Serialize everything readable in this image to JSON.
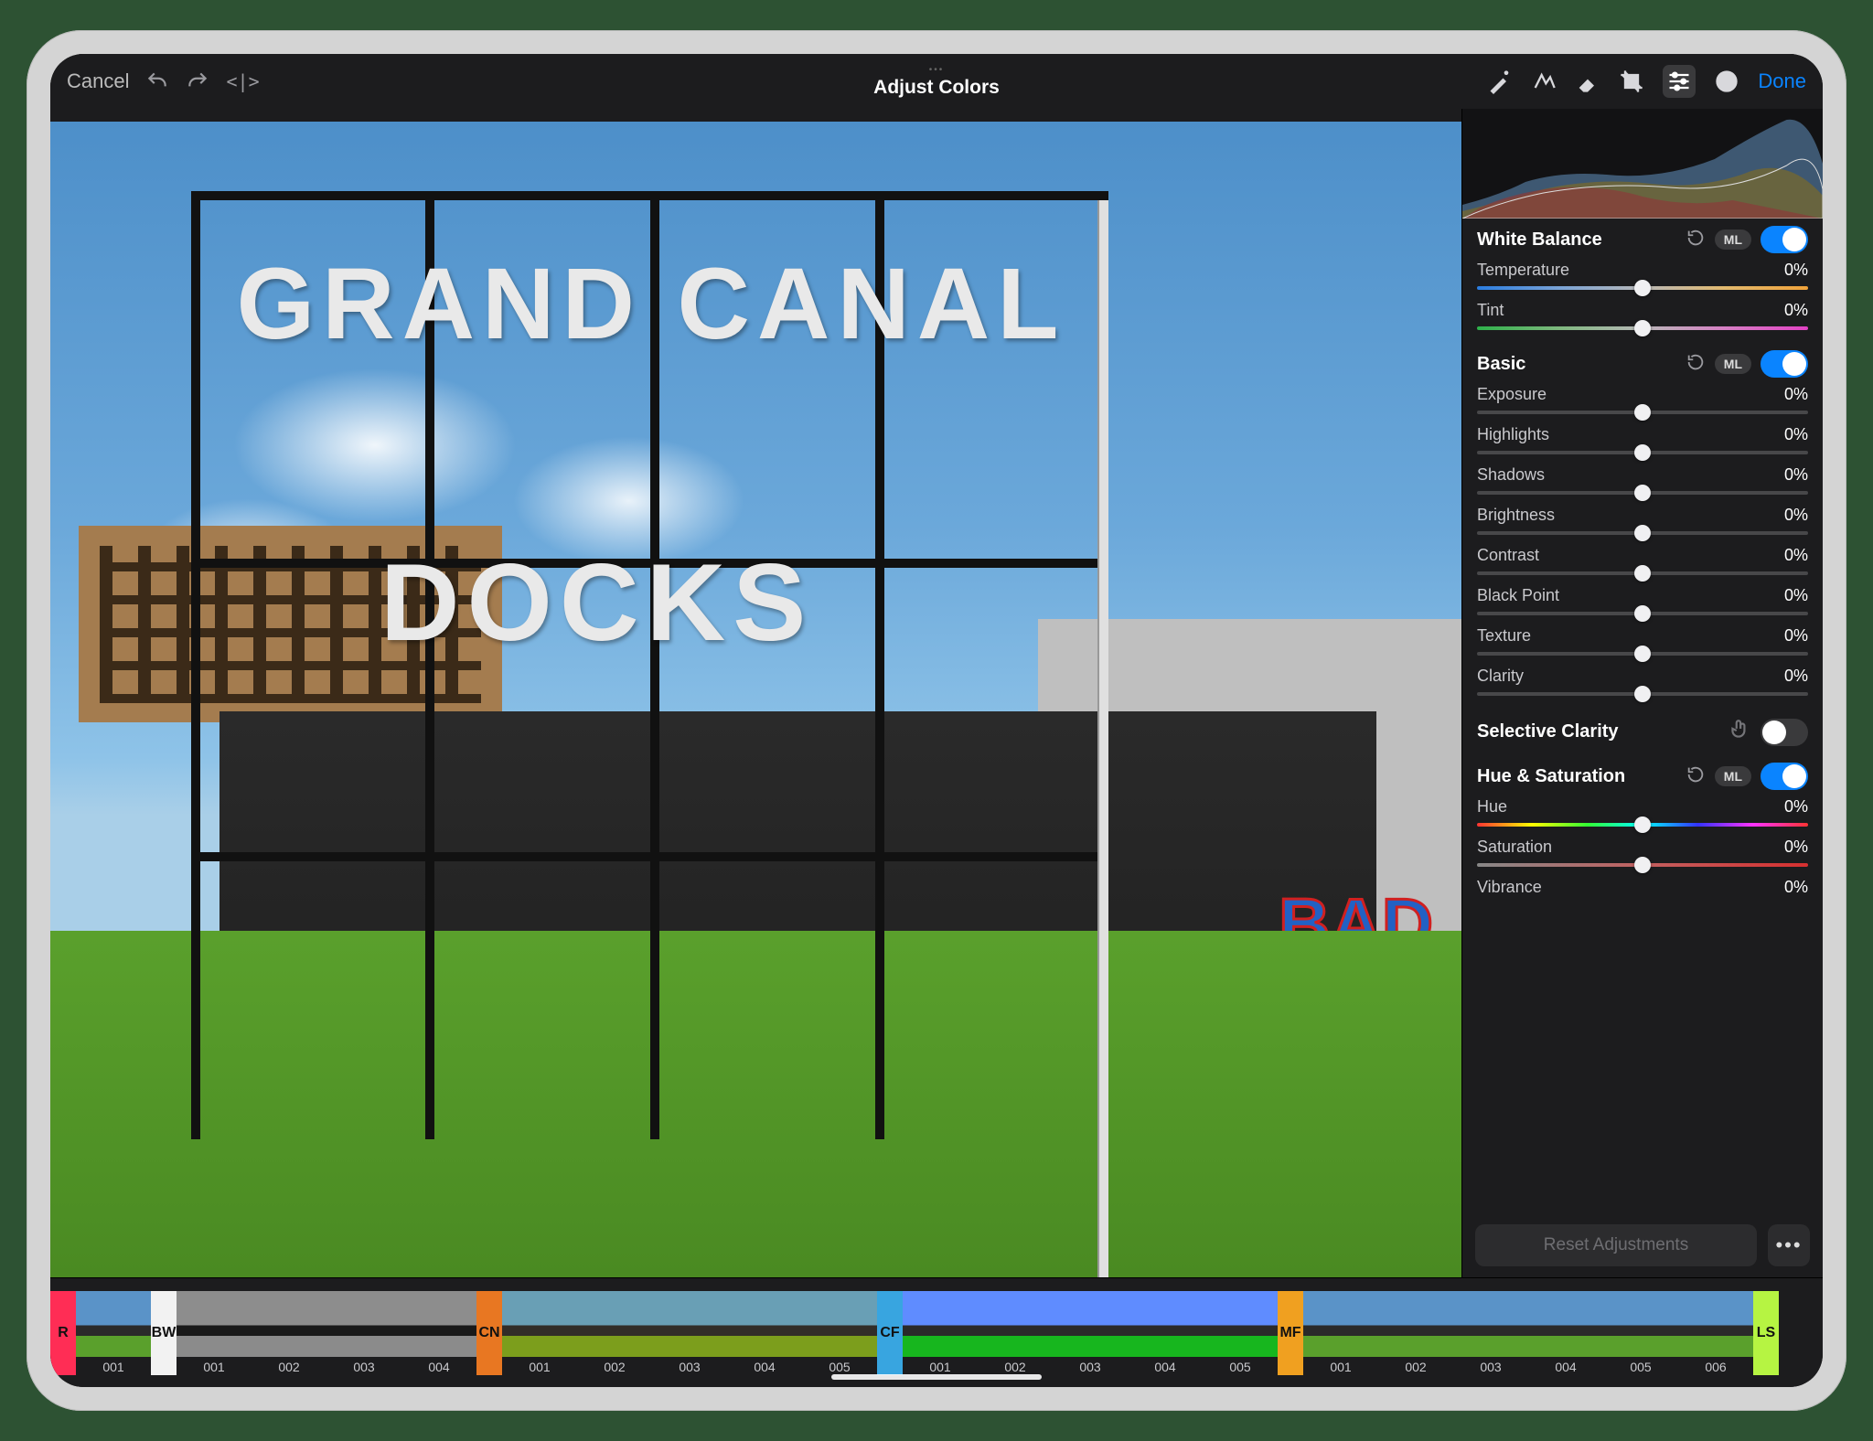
{
  "topbar": {
    "cancel": "Cancel",
    "title": "Adjust Colors",
    "done": "Done"
  },
  "photo": {
    "sign_line1": "GRAND CANAL",
    "sign_line2": "DOCKS",
    "graffiti": "BAD"
  },
  "sidebar": {
    "white_balance": {
      "title": "White Balance",
      "ml": "ML"
    },
    "temperature": {
      "label": "Temperature",
      "value": "0%"
    },
    "tint": {
      "label": "Tint",
      "value": "0%"
    },
    "basic": {
      "title": "Basic",
      "ml": "ML"
    },
    "exposure": {
      "label": "Exposure",
      "value": "0%"
    },
    "highlights": {
      "label": "Highlights",
      "value": "0%"
    },
    "shadows": {
      "label": "Shadows",
      "value": "0%"
    },
    "brightness": {
      "label": "Brightness",
      "value": "0%"
    },
    "contrast": {
      "label": "Contrast",
      "value": "0%"
    },
    "black_point": {
      "label": "Black Point",
      "value": "0%"
    },
    "texture": {
      "label": "Texture",
      "value": "0%"
    },
    "clarity": {
      "label": "Clarity",
      "value": "0%"
    },
    "selective_clarity": {
      "title": "Selective Clarity"
    },
    "hue_sat": {
      "title": "Hue & Saturation",
      "ml": "ML"
    },
    "hue": {
      "label": "Hue",
      "value": "0%"
    },
    "saturation": {
      "label": "Saturation",
      "value": "0%"
    },
    "vibrance": {
      "label": "Vibrance",
      "value": "0%"
    },
    "reset": "Reset Adjustments"
  },
  "chips": {
    "r": "R",
    "bw": "BW",
    "cn": "CN",
    "cf": "CF",
    "mf": "MF",
    "ls": "LS"
  },
  "filters": {
    "r": [
      {
        "label": "001"
      }
    ],
    "bw": [
      {
        "label": "001"
      },
      {
        "label": "002"
      },
      {
        "label": "003"
      },
      {
        "label": "004"
      }
    ],
    "cn": [
      {
        "label": "001"
      },
      {
        "label": "002"
      },
      {
        "label": "003"
      },
      {
        "label": "004"
      },
      {
        "label": "005"
      }
    ],
    "cf": [
      {
        "label": "001"
      },
      {
        "label": "002"
      },
      {
        "label": "003"
      },
      {
        "label": "004"
      },
      {
        "label": "005"
      }
    ],
    "mf": [
      {
        "label": "001"
      },
      {
        "label": "002"
      },
      {
        "label": "003"
      },
      {
        "label": "004"
      },
      {
        "label": "005"
      },
      {
        "label": "006"
      }
    ]
  }
}
